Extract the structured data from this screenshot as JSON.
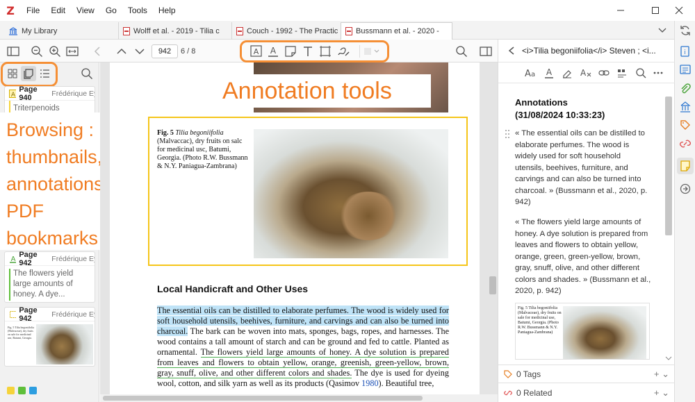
{
  "menu": {
    "logo": "Z",
    "items": [
      "File",
      "Edit",
      "View",
      "Go",
      "Tools",
      "Help"
    ]
  },
  "tabs": {
    "library": "My Library",
    "items": [
      {
        "label": "Wolff et al. - 2019 - Tilia c"
      },
      {
        "label": "Couch - 1992 - The Practic"
      },
      {
        "label": "Bussmann et al. - 2020 - "
      }
    ]
  },
  "toolbar": {
    "page_input": "942",
    "page_count": "6 / 8"
  },
  "sidebar": {
    "cards": [
      {
        "page": "Page 940",
        "author": "Frédérique Eyn",
        "text": "Triterpenoids"
      },
      {
        "page": "Page 942",
        "author": "Frédérique Eyn",
        "text": "The flowers yield large amounts of honey. A dye..."
      },
      {
        "page": "Page 942",
        "author": "Frédérique Eyn",
        "thumb_caption": "Fig. 5 Tilia begoniifolia (Malvaceae), dry fruits on sale for medicinal use, Batumi, Georgia."
      }
    ],
    "colors": [
      "#f5d33a",
      "#5fbf3a",
      "#2d9ee0"
    ]
  },
  "callouts": {
    "annotation_tools": "Annotation tools",
    "browsing": [
      "Browsing :",
      "thumbnails,",
      "annotations,",
      "PDF",
      "bookmarks"
    ]
  },
  "pdf": {
    "fig_label": "Fig. 5",
    "fig_title": "Tilia begoniifolia",
    "fig_caption": "(Malvaccac), dry fruits on salc for medicinal usc, Batumi, Georgia. (Photo R.W. Bussmann & N.Y. Paniagua-Zambrana)",
    "heading": "Local Handicraft and Other Uses",
    "para_highlight": "The essential oils can be distilled to elaborate perfumes. The wood is widely used for soft household utensils, beehives, furniture, and carvings and can also be turned into charcoal.",
    "para_mid": " The bark can be woven into mats, sponges, bags, ropes, and harnesses. The wood contains a tall amount of starch and can be ground and fed to cattle. Planted as ornamental. ",
    "para_underline": "The flowers yield large amounts of honey. A dye solution is prepared from leaves and flowers to obtain yellow, orange, greenish, green-yellow, brown, gray, snuff, olive, and other different colors and shades.",
    "para_end": " The dye is used for dyeing wool, cotton, and silk yarn as well as its products (Qasimov ",
    "para_cite": "1980",
    "para_tail": "). Beautiful tree,"
  },
  "notes": {
    "header_title": "<i>Tilia begoniifolia</i> Steven ; <i...",
    "title_line1": "Annotations",
    "title_line2": "(31/08/2024 10:33:23)",
    "quote1": "« The essential oils can be distilled to elaborate perfumes. The wood is widely used for soft household utensils, beehives, furniture, and carvings and can also be turned into charcoal. » (Bussmann et al., 2020, p. 942)",
    "quote2": "« The flowers yield large amounts of honey. A dye solution is prepared from leaves and flowers to obtain yellow, orange, green, green-yellow, brown, gray, snuff, olive, and other different colors and shades. » (Bussmann et al., 2020, p. 942)",
    "thumb_caption": "Fig. 5 Tilia begoniifolia (Malvaceae), dry fruits on sale for medicinal use, Batumi, Georgia. (Photo R.W. Bussmann & N.Y. Paniagua-Zambrana)",
    "tags_label": "0 Tags",
    "related_label": "0 Related"
  }
}
